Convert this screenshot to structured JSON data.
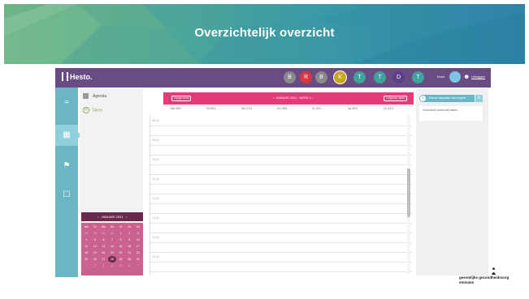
{
  "slide": {
    "title": "Overzichtelijk overzicht"
  },
  "app": {
    "logo": "Hesto.",
    "avatars": [
      {
        "letter": "B",
        "color": "#8a8a8a"
      },
      {
        "letter": "R",
        "color": "#d9363e"
      },
      {
        "letter": "B",
        "color": "#8a8a8a"
      },
      {
        "letter": "K",
        "color": "#c9a71f"
      },
      {
        "letter": "T",
        "color": "#3ea39a"
      },
      {
        "letter": "T",
        "color": "#3ea39a"
      },
      {
        "letter": "D",
        "color": "#5a3f8a"
      },
      {
        "letter": "T",
        "color": "#3ea39a"
      }
    ],
    "user": {
      "name": "Koen",
      "logout": "Uitloggen"
    }
  },
  "left_panel": {
    "agenda_label": "Agenda",
    "add_label": "Taken",
    "mini_calendar": {
      "month": "JANUARI 2021",
      "weekdays": [
        "Ma",
        "Di",
        "Wo",
        "Do",
        "Vr",
        "Za",
        "Zo"
      ],
      "days": [
        "28",
        "29",
        "30",
        "31",
        "1",
        "2",
        "3",
        "4",
        "5",
        "6",
        "7",
        "8",
        "9",
        "10",
        "11",
        "12",
        "13",
        "14",
        "15",
        "16",
        "17",
        "18",
        "19",
        "20",
        "21",
        "22",
        "23",
        "24",
        "25",
        "26",
        "27",
        "28",
        "29",
        "30",
        "31",
        "1",
        "2",
        "3",
        "4",
        "5",
        "6",
        "7"
      ],
      "selected": "28"
    }
  },
  "calendar": {
    "prev_button": "Vorige week",
    "next_button": "Volgende week",
    "title": "JANUARI 2021 · WEEK 4",
    "days": [
      "Ma 25/1",
      "Di 26/1",
      "Wo 27/1",
      "Do 28/1",
      "Vr 29/1",
      "Za 30/1",
      "Zo 31/1"
    ],
    "hours": [
      "08:00",
      "09:00",
      "10:00",
      "11:00",
      "12:00",
      "13:00",
      "14:00",
      "15:00"
    ]
  },
  "right_panel": {
    "button": "Nieuw afspraak toevoegen",
    "card_text": "Overzicht komende taken"
  },
  "footer": {
    "org": "geestelijke gezondheidszorg",
    "place": "emmaüs"
  }
}
